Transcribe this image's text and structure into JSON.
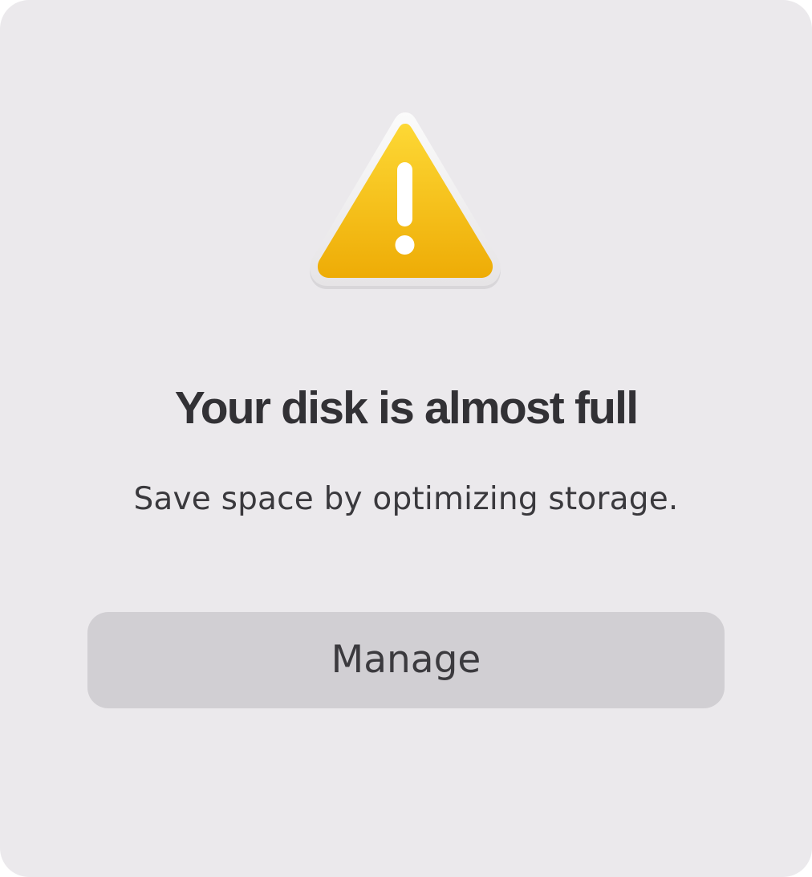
{
  "dialog": {
    "icon": "warning-triangle-icon",
    "title": "Your disk is almost full",
    "message": "Save space by optimizing storage.",
    "manage_label": "Manage"
  },
  "colors": {
    "background": "#ebe9ec",
    "button": "#d1cfd3",
    "text": "#323135",
    "warning_yellow_top": "#fdd835",
    "warning_yellow_bottom": "#eeac06"
  }
}
